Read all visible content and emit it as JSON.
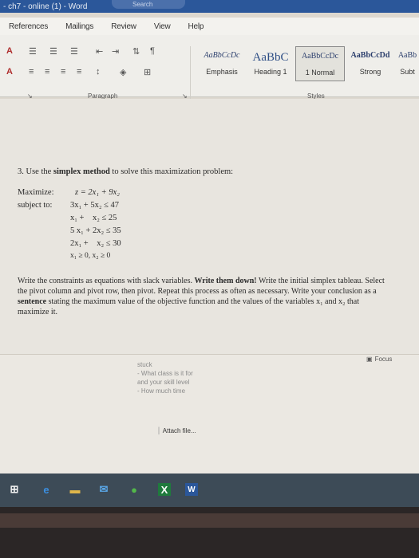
{
  "titlebar": {
    "title": "- ch7 - online (1)  -  Word",
    "search": "Search"
  },
  "ribbon": {
    "tabs": [
      "References",
      "Mailings",
      "Review",
      "View",
      "Help"
    ],
    "styles": [
      {
        "sample": "AaBbCcDc",
        "name": "Emphasis"
      },
      {
        "sample": "AaBbC",
        "name": "Heading 1"
      },
      {
        "sample": "AaBbCcDc",
        "name": "1 Normal"
      },
      {
        "sample": "AaBbCcDd",
        "name": "Strong"
      },
      {
        "sample": "AaBb",
        "name": "Subt"
      }
    ],
    "group_paragraph": "Paragraph",
    "group_styles": "Styles"
  },
  "document": {
    "question_number": "3.",
    "question_pre": "Use the ",
    "question_bold": "simplex method",
    "question_post": " to solve this maximization problem:",
    "maximize_label": "Maximize:",
    "subject_label": "subject to:",
    "objective": "z = 2x₁ + 9x₂",
    "constraints": [
      "3x₁ + 5x₂ ≤ 47",
      "x₁ +    x₂ ≤ 25",
      "5 x₁ + 2x₂ ≤ 35",
      "2x₁ +    x₂ ≤ 30"
    ],
    "nonneg": "x₁ ≥ 0, x₂ ≥ 0",
    "instructions": [
      "Write the constraints as equations with slack variables. ",
      "Write them down!",
      " Write the initial simplex tableau. Select the pivot column and pivot row, then pivot. Repeat this process as often as necessary. Write your conclusion as a ",
      "sentence",
      " stating the maximum value of the objective function and the values of the variables x₁ and x₂ that maximize it."
    ]
  },
  "lower": {
    "focus": "Focus",
    "reply_lines": [
      "stuck",
      "- What class is it for",
      "and your skill level",
      "- How much time"
    ],
    "attach": "Attach file..."
  }
}
